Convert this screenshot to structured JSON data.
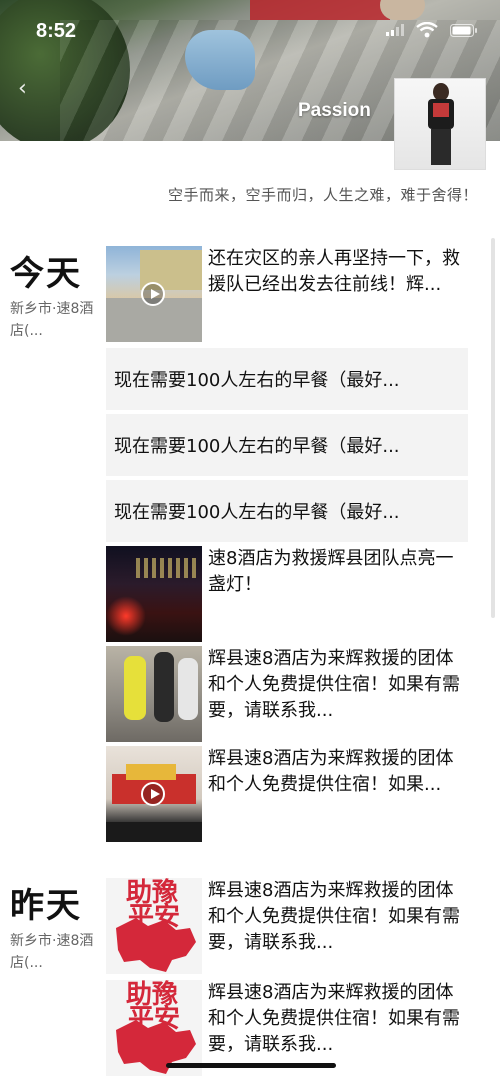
{
  "status_bar": {
    "time": "8:52"
  },
  "profile": {
    "username": "Passion",
    "signature": "空手而来，空手而归，人生之难，难于舍得！"
  },
  "days": [
    {
      "label": "今天",
      "location": "新乡市·速8酒店(..."
    },
    {
      "label": "昨天",
      "location": "新乡市·速8酒店(..."
    }
  ],
  "posts": [
    {
      "text": "还在灾区的亲人再坚持一下，救援队已经出发去往前线！辉...",
      "thumb_icon": "video-thumbnail"
    },
    {
      "text": "现在需要100人左右的早餐（最好..."
    },
    {
      "text": "现在需要100人左右的早餐（最好..."
    },
    {
      "text": "现在需要100人左右的早餐（最好..."
    },
    {
      "text": "速8酒店为救援辉县团队点亮一盏灯！",
      "thumb_icon": "photo-thumbnail"
    },
    {
      "text": "辉县速8酒店为来辉救援的团体和个人免费提供住宿！如果有需要，请联系我...",
      "thumb_icon": "photo-thumbnail"
    },
    {
      "text": "辉县速8酒店为来辉救援的团体和个人免费提供住宿！如果...",
      "thumb_icon": "video-thumbnail"
    },
    {
      "text": "辉县速8酒店为来辉救援的团体和个人免费提供住宿！如果有需要，请联系我...",
      "thumb_text": "平安",
      "thumb_text_top": "助豫"
    },
    {
      "text": "辉县速8酒店为来辉救援的团体和个人免费提供住宿！如果有需要，请联系我...",
      "thumb_text": "平安",
      "thumb_text_top": "助豫"
    }
  ]
}
